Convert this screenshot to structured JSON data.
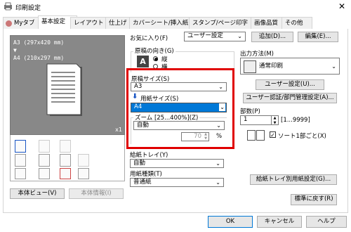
{
  "window": {
    "title": "印刷設定",
    "close_glyph": "✕"
  },
  "tabs": [
    "Myタブ",
    "基本設定",
    "レイアウト",
    "仕上げ",
    "カバーシート/挿入紙",
    "スタンプ/ページ印字",
    "画像品質",
    "その他"
  ],
  "preview": {
    "text": "A3 (297x420 mm)\n▼\nA4 (210x297 mm)",
    "scale": "x1"
  },
  "buttons": {
    "view": "本体ビュー(V)",
    "info": "本体情報(I)"
  },
  "favorites": {
    "label": "お気に入り(F)",
    "value": "ユーザー設定",
    "add": "追加(D)...",
    "edit": "編集(E)..."
  },
  "orientation": {
    "label": "原稿の向き(G)",
    "portrait": "縦",
    "landscape": "横",
    "selected": "portrait"
  },
  "original_size": {
    "label": "原稿サイズ(S)",
    "value": "A3"
  },
  "paper_size": {
    "label": "用紙サイズ(S)",
    "value": "A4"
  },
  "zoom": {
    "label": "ズーム [25...400%](Z)",
    "value": "自動",
    "percent": "70",
    "unit": "%"
  },
  "paper_tray": {
    "label": "給紙トレイ(Y)",
    "value": "自動"
  },
  "paper_type": {
    "label": "用紙種類(T)",
    "value": "普通紙"
  },
  "output_method": {
    "label": "出力方法(M)",
    "value": "通常印刷"
  },
  "user_settings": "ユーザー設定(U)...",
  "auth_settings": "ユーザー認証/部門管理設定(A)...",
  "copies": {
    "label": "部数(P)",
    "value": "1",
    "range": "[1...9999]",
    "collate": "ソート1部ごと(X)",
    "collate_checked": true
  },
  "tray_paper_settings": "給紙トレイ別用紙設定(G)...",
  "restore_defaults": "標準に戻す(R)",
  "dialog": {
    "ok": "OK",
    "cancel": "キャンセル",
    "help": "ヘルプ"
  },
  "colors": {
    "highlight": "#0078d7",
    "callout": "#e00000",
    "preview_bg": "#888888"
  }
}
